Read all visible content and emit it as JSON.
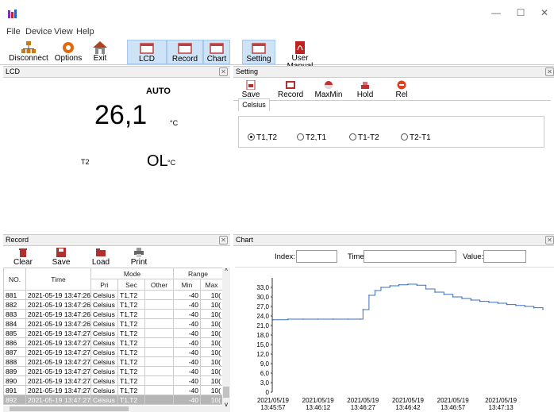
{
  "window": {
    "minimize": "—",
    "maximize": "☐",
    "close": "✕"
  },
  "menu": [
    "File",
    "Device",
    "View",
    "Help"
  ],
  "toolbar": {
    "disconnect": "Disconnect",
    "options": "Options",
    "exit": "Exit",
    "lcd": "LCD",
    "record": "Record",
    "chart": "Chart",
    "setting": "Setting",
    "user_manual": "User Manual"
  },
  "lcd": {
    "title": "LCD",
    "mode": "AUTO",
    "value1": "26,1",
    "unit1": "°C",
    "label2": "T2",
    "value2": "OL",
    "unit2": "°C"
  },
  "setting": {
    "title": "Setting",
    "buttons": [
      "Save",
      "Record",
      "MaxMin",
      "Hold",
      "Rel"
    ],
    "tab": "Celsius",
    "options": [
      "T1,T2",
      "T2,T1",
      "T1-T2",
      "T2-T1"
    ],
    "selected": "T1,T2"
  },
  "record": {
    "title": "Record",
    "buttons": [
      "Clear",
      "Save",
      "Load",
      "Print"
    ],
    "headers": {
      "no": "NO.",
      "time": "Time",
      "mode": "Mode",
      "range": "Range",
      "pri": "Pri",
      "sec": "Sec",
      "other": "Other",
      "min": "Min",
      "max": "Max"
    },
    "rows": [
      {
        "no": "881",
        "time": "2021-05-19 13:47:26",
        "pri": "Celsius",
        "sec": "T1,T2",
        "other": "",
        "min": "-40",
        "max": "10("
      },
      {
        "no": "882",
        "time": "2021-05-19 13:47:26",
        "pri": "Celsius",
        "sec": "T1,T2",
        "other": "",
        "min": "-40",
        "max": "10("
      },
      {
        "no": "883",
        "time": "2021-05-19 13:47:26",
        "pri": "Celsius",
        "sec": "T1,T2",
        "other": "",
        "min": "-40",
        "max": "10("
      },
      {
        "no": "884",
        "time": "2021-05-19 13:47:26",
        "pri": "Celsius",
        "sec": "T1,T2",
        "other": "",
        "min": "-40",
        "max": "10("
      },
      {
        "no": "885",
        "time": "2021-05-19 13:47:27",
        "pri": "Celsius",
        "sec": "T1,T2",
        "other": "",
        "min": "-40",
        "max": "10("
      },
      {
        "no": "886",
        "time": "2021-05-19 13:47:27",
        "pri": "Celsius",
        "sec": "T1,T2",
        "other": "",
        "min": "-40",
        "max": "10("
      },
      {
        "no": "887",
        "time": "2021-05-19 13:47:27",
        "pri": "Celsius",
        "sec": "T1,T2",
        "other": "",
        "min": "-40",
        "max": "10("
      },
      {
        "no": "888",
        "time": "2021-05-19 13:47:27",
        "pri": "Celsius",
        "sec": "T1,T2",
        "other": "",
        "min": "-40",
        "max": "10("
      },
      {
        "no": "889",
        "time": "2021-05-19 13:47:27",
        "pri": "Celsius",
        "sec": "T1,T2",
        "other": "",
        "min": "-40",
        "max": "10("
      },
      {
        "no": "890",
        "time": "2021-05-19 13:47:27",
        "pri": "Celsius",
        "sec": "T1,T2",
        "other": "",
        "min": "-40",
        "max": "10("
      },
      {
        "no": "891",
        "time": "2021-05-19 13:47:27",
        "pri": "Celsius",
        "sec": "T1,T2",
        "other": "",
        "min": "-40",
        "max": "10("
      },
      {
        "no": "892",
        "time": "2021-05-19 13:47:27",
        "pri": "Celsius",
        "sec": "T1,T2",
        "other": "",
        "min": "-40",
        "max": "10("
      }
    ]
  },
  "chart_panel": {
    "title": "Chart",
    "index_label": "Index:",
    "time_label": "Time:",
    "value_label": "Value:"
  },
  "chart_data": {
    "type": "line",
    "yticks": [
      "33,0",
      "30,0",
      "27,0",
      "24,0",
      "21,0",
      "18,0",
      "15,0",
      "12,0",
      "9,0",
      "6,0",
      "3,0",
      "0"
    ],
    "ylim": [
      0,
      36
    ],
    "xticks": [
      [
        "2021/05/19",
        "13:45:57"
      ],
      [
        "2021/05/19",
        "13:46:12"
      ],
      [
        "2021/05/19",
        "13:46:27"
      ],
      [
        "2021/05/19",
        "13:46:42"
      ],
      [
        "2021/05/19",
        "13:46:57"
      ],
      [
        "2021/05/19",
        "13:47:13"
      ]
    ],
    "x": [
      "13:45:57",
      "13:46:02",
      "13:46:07",
      "13:46:12",
      "13:46:17",
      "13:46:22",
      "13:46:26",
      "13:46:27",
      "13:46:29",
      "13:46:31",
      "13:46:33",
      "13:46:36",
      "13:46:39",
      "13:46:42",
      "13:46:45",
      "13:46:48",
      "13:46:51",
      "13:46:54",
      "13:46:57",
      "13:47:00",
      "13:47:03",
      "13:47:06",
      "13:47:09",
      "13:47:12",
      "13:47:15",
      "13:47:18",
      "13:47:21",
      "13:47:24",
      "13:47:27"
    ],
    "values": [
      22.8,
      23.0,
      23.0,
      23.0,
      23.0,
      23.0,
      23.0,
      26.0,
      30.5,
      32.0,
      33.0,
      33.5,
      33.8,
      34.0,
      33.7,
      32.5,
      31.5,
      30.8,
      30.0,
      29.5,
      29.0,
      28.6,
      28.3,
      28.0,
      27.6,
      27.3,
      27.0,
      26.6,
      26.1
    ],
    "color": "#3a6fc4"
  }
}
